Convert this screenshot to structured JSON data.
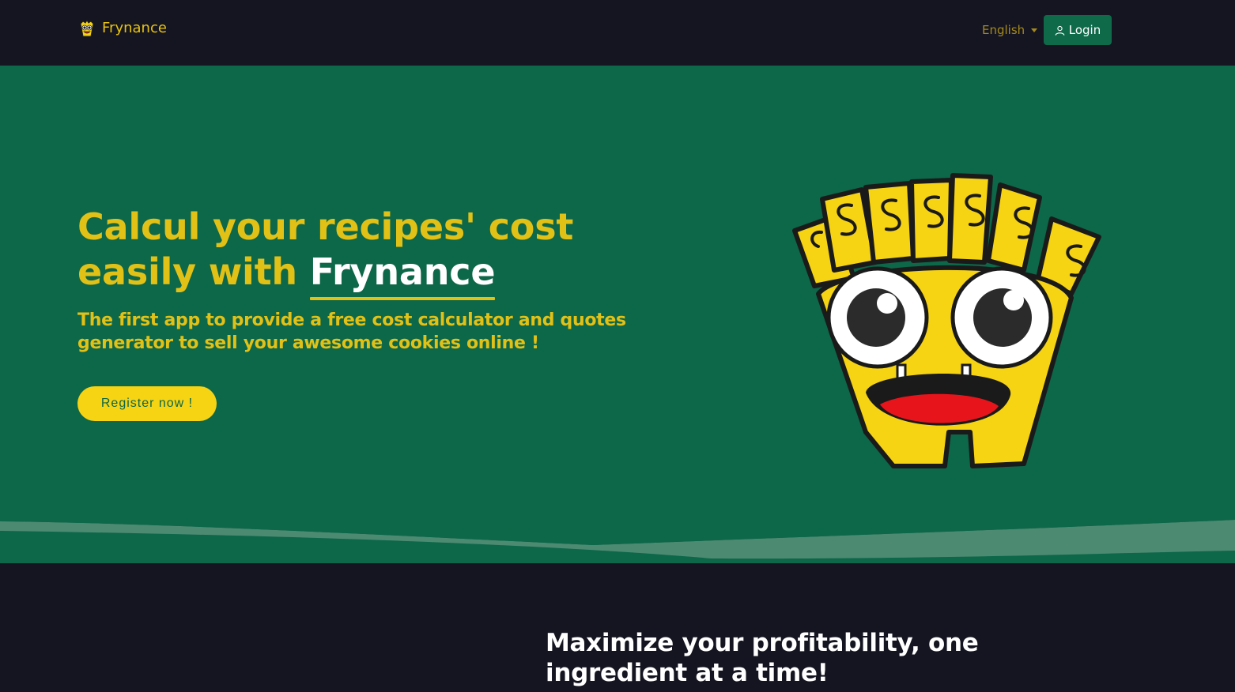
{
  "navbar": {
    "brand_name": "Frynance",
    "language": "English",
    "login_label": "Login"
  },
  "hero": {
    "title_prefix": "Calcul your recipes' cost easily with ",
    "title_highlight": "Frynance",
    "subtitle": "The first app to provide a free cost calculator and quotes generator to sell your awesome cookies online !",
    "register_label": "Register now !"
  },
  "section2": {
    "title": "Maximize your profitability, one ingredient at a time!"
  },
  "colors": {
    "nav_bg": "#151521",
    "hero_bg": "#0d6749",
    "accent_yellow": "#e2c117",
    "button_yellow": "#f6d313",
    "login_green": "#0f6a4a"
  },
  "icons": {
    "brand": "fries-mascot-icon",
    "login": "user-icon",
    "language": "caret-down-icon",
    "hero_image": "fries-mascot-illustration"
  }
}
